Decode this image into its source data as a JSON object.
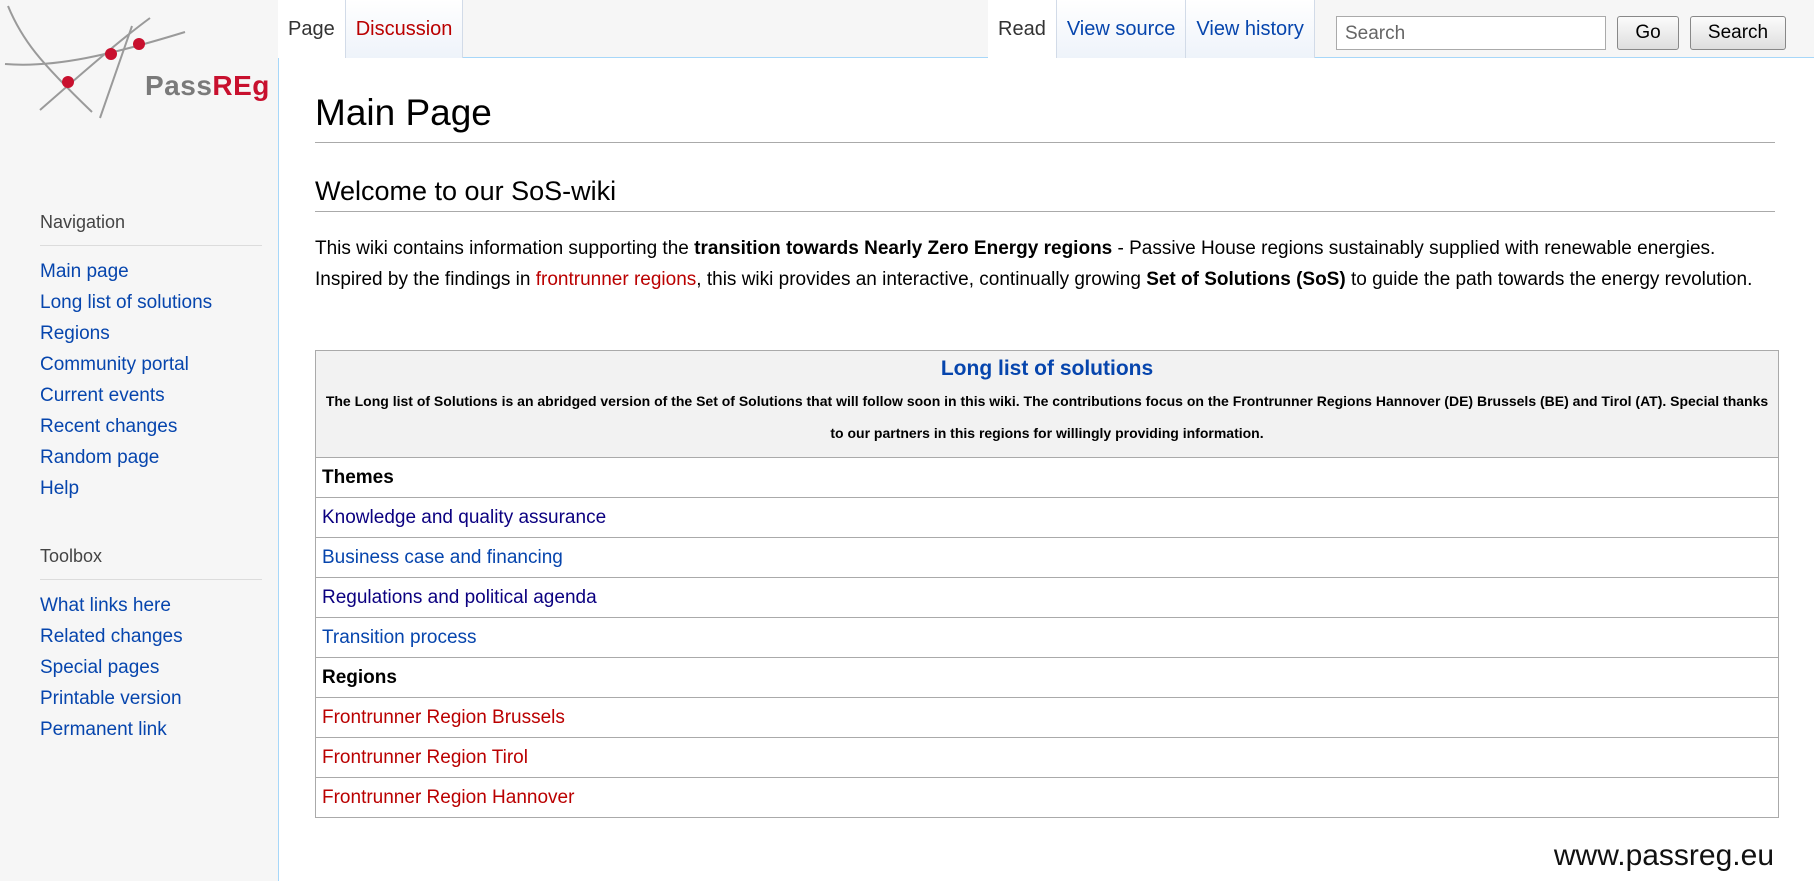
{
  "logo": {
    "text_pass": "Pass",
    "text_reg": "REg"
  },
  "tabs": {
    "page": "Page",
    "discussion": "Discussion",
    "read": "Read",
    "view_source": "View source",
    "view_history": "View history"
  },
  "search": {
    "placeholder": "Search",
    "go_label": "Go",
    "search_label": "Search"
  },
  "sidebar": {
    "navigation": {
      "heading": "Navigation",
      "items": [
        "Main page",
        "Long list of solutions",
        "Regions",
        "Community portal",
        "Current events",
        "Recent changes",
        "Random page",
        "Help"
      ]
    },
    "toolbox": {
      "heading": "Toolbox",
      "items": [
        "What links here",
        "Related changes",
        "Special pages",
        "Printable version",
        "Permanent link"
      ]
    }
  },
  "content": {
    "title": "Main Page",
    "welcome_heading": "Welcome to our SoS-wiki",
    "intro": {
      "p1": "This wiki contains information supporting the ",
      "b1": "transition towards Nearly Zero Energy regions",
      "p2": " - Passive House regions sustainably supplied with renewable energies. Inspired by the findings in ",
      "link": "frontrunner regions",
      "p3": ", this wiki provides an interactive, continually growing ",
      "b2": "Set of Solutions (SoS)",
      "p4": " to guide the path towards the energy revolution."
    },
    "table": {
      "title": "Long list of solutions",
      "description": "The Long list of Solutions is an abridged version of the Set of Solutions that will follow soon in this wiki. The contributions focus on the Frontrunner Regions Hannover (DE) Brussels (BE) and Tirol (AT). Special thanks to our partners in this regions for willingly providing information.",
      "themes_heading": "Themes",
      "themes": [
        "Knowledge and quality assurance",
        "Business case and financing",
        "Regulations and political agenda",
        "Transition process"
      ],
      "regions_heading": "Regions",
      "regions": [
        "Frontrunner Region Brussels",
        "Frontrunner Region Tirol",
        "Frontrunner Region Hannover"
      ]
    }
  },
  "footer_url": "www.passreg.eu",
  "colors": {
    "link": "#0645ad",
    "visited": "#0b0080",
    "new_link": "#ba0000",
    "border": "#a7d7f9"
  }
}
